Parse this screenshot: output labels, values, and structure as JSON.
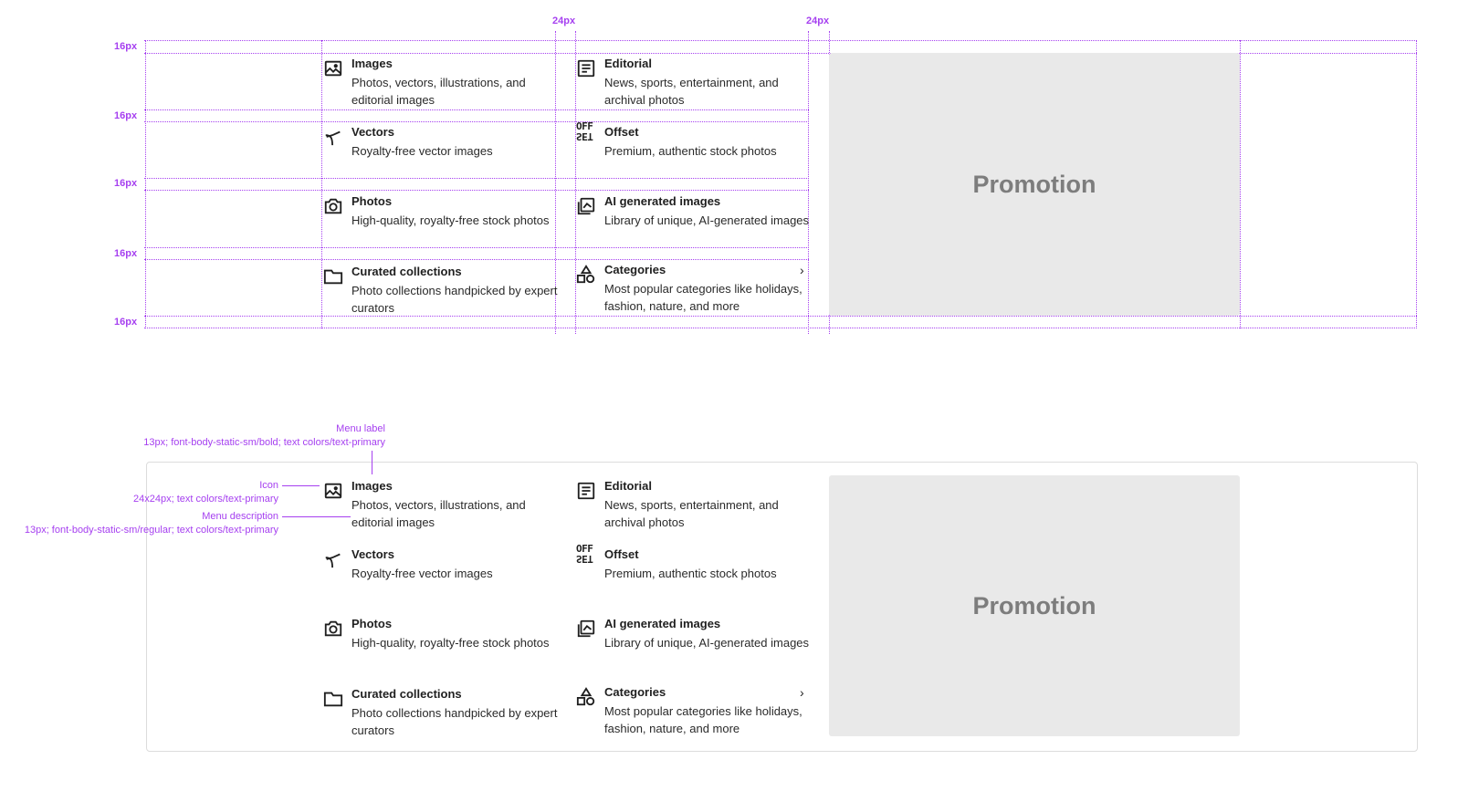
{
  "spec": {
    "gap_16": "16px",
    "gap_24": "24px"
  },
  "menu": {
    "left_column": [
      {
        "icon": "image-icon",
        "label": "Images",
        "description": "Photos, vectors, illustrations, and editorial images"
      },
      {
        "icon": "vector-icon",
        "label": "Vectors",
        "description": "Royalty-free vector images"
      },
      {
        "icon": "camera-icon",
        "label": "Photos",
        "description": "High-quality, royalty-free stock photos"
      },
      {
        "icon": "folder-icon",
        "label": "Curated collections",
        "description": "Photo collections handpicked by expert curators"
      }
    ],
    "right_column": [
      {
        "icon": "editorial-icon",
        "label": "Editorial",
        "description": "News, sports, entertainment, and archival photos"
      },
      {
        "icon": "offset-logo-icon",
        "label": "Offset",
        "description": "Premium, authentic stock photos",
        "logo_top": "OFF",
        "logo_bottom": "SET"
      },
      {
        "icon": "ai-images-icon",
        "label": "AI generated images",
        "description": "Library of unique, AI-generated images"
      },
      {
        "icon": "categories-icon",
        "label": "Categories",
        "description": "Most popular categories like holidays, fashion, nature, and more",
        "chevron": "›"
      }
    ],
    "promotion": "Promotion"
  },
  "annotations": {
    "menu_label_title": "Menu label",
    "menu_label_spec": "13px; font-body-static-sm/bold; text colors/text-primary",
    "icon_title": "Icon",
    "icon_spec": "24x24px; text colors/text-primary",
    "menu_desc_title": "Menu description",
    "menu_desc_spec": "13px; font-body-static-sm/regular; text colors/text-primary"
  },
  "colors": {
    "spec_accent": "#a640f0",
    "text_primary": "#1f1f1f",
    "promo_bg": "#e9e9e9",
    "promo_text": "#7d7d7d"
  }
}
